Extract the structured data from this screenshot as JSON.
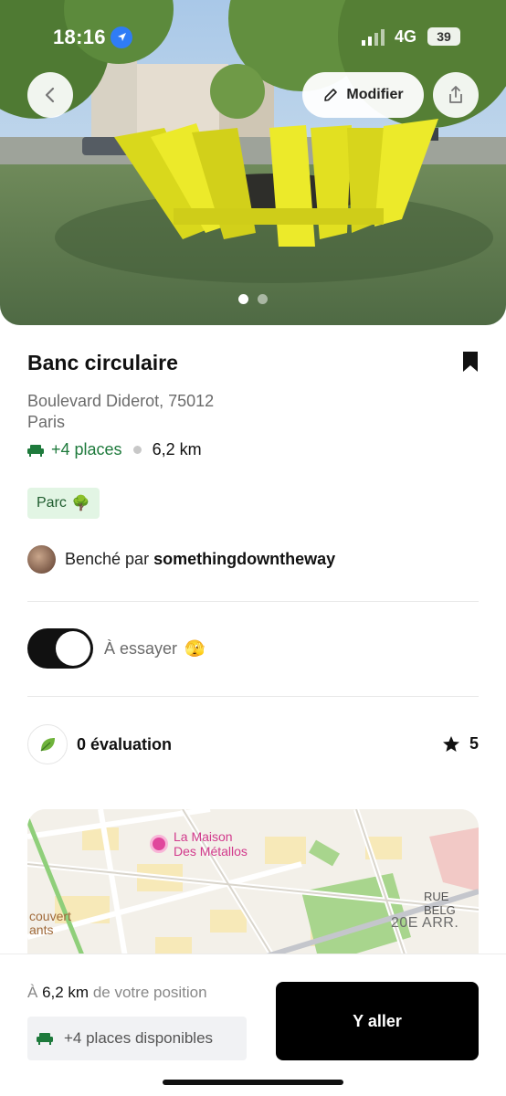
{
  "status_bar": {
    "time": "18:16",
    "network": "4G",
    "battery": "39"
  },
  "hero": {
    "back_icon": "chevron-left-icon",
    "edit_label": "Modifier",
    "edit_icon": "pencil-icon",
    "share_icon": "share-icon",
    "photo_count": 2,
    "active_photo": 1
  },
  "bench": {
    "title": "Banc circulaire",
    "address_line1": "Boulevard Diderot, 75012",
    "address_line2": "Paris",
    "places": "+4 places",
    "distance": "6,2 km",
    "tag": "Parc",
    "tag_emoji": "🌳",
    "author_prefix": "Benché par",
    "author_name": "somethingdowntheway"
  },
  "toggle": {
    "label": "À essayer",
    "emoji": "🫣",
    "checked": true
  },
  "rating": {
    "count_label": "0 évaluation",
    "score": "5"
  },
  "map": {
    "poi_name_line1": "La Maison",
    "poi_name_line2": "Des Métallos",
    "street_label": "RUE BELG",
    "district_label": "20E ARR.",
    "edge_label_line1": "couvert",
    "edge_label_line2": "ants"
  },
  "bottom_bar": {
    "position_prefix": "À",
    "position_distance": "6,2 km",
    "position_suffix": "de votre position",
    "available_label": "+4 places disponibles",
    "go_label": "Y aller"
  },
  "colors": {
    "accent_green": "#1e7a3c",
    "bench_yellow": "#e7e41f",
    "tag_bg": "#e2f5e4",
    "primary_button": "#000000"
  }
}
